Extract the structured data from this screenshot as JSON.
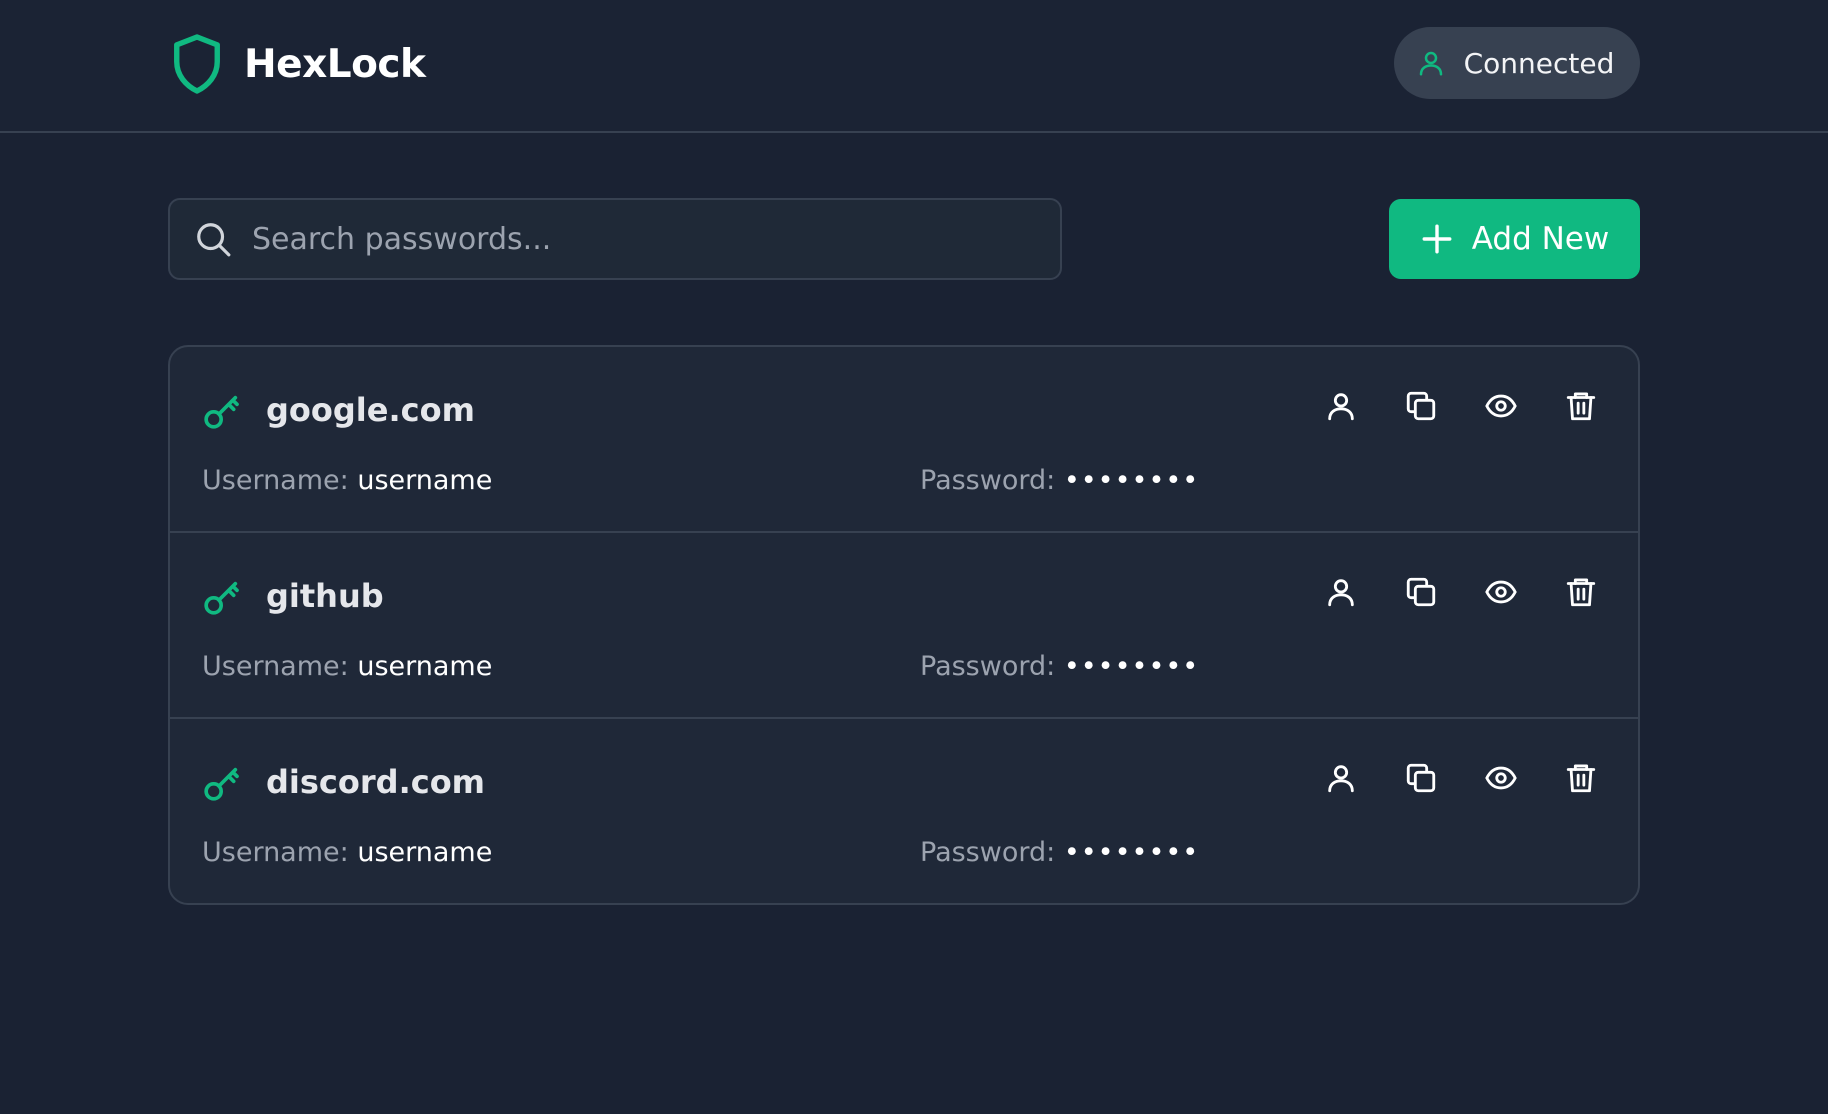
{
  "app": {
    "name": "HexLock",
    "status": "Connected"
  },
  "search": {
    "placeholder": "Search passwords...",
    "value": ""
  },
  "toolbar": {
    "add_label": "Add New"
  },
  "labels": {
    "username": "Username:",
    "password": "Password:"
  },
  "entries": [
    {
      "site": "google.com",
      "username": "username",
      "password_masked": "••••••••"
    },
    {
      "site": "github",
      "username": "username",
      "password_masked": "••••••••"
    },
    {
      "site": "discord.com",
      "username": "username",
      "password_masked": "••••••••"
    }
  ],
  "icons": {
    "logo": "shield-icon",
    "status": "user-icon",
    "search": "search-icon",
    "add": "plus-icon",
    "entry": "key-icon",
    "actions": [
      "user-icon",
      "copy-icon",
      "eye-icon",
      "trash-icon"
    ]
  },
  "colors": {
    "accent": "#10b981",
    "background": "#1a2233",
    "panel": "#1f2838",
    "border": "#374151"
  }
}
